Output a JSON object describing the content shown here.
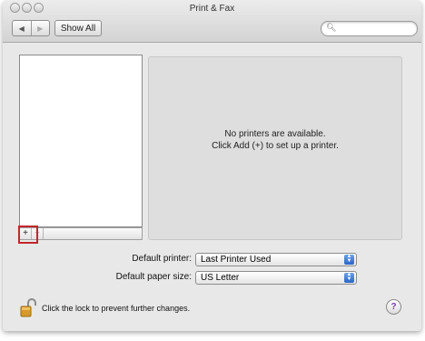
{
  "window": {
    "title": "Print & Fax",
    "toolbar": {
      "back_glyph": "◀",
      "forward_glyph": "▶",
      "show_all_label": "Show All",
      "search_placeholder": ""
    }
  },
  "printers": {
    "list_items": [],
    "add_glyph": "+",
    "remove_glyph": "−",
    "empty_message_line1": "No printers are available.",
    "empty_message_line2": "Click Add (+) to set up a printer."
  },
  "settings": {
    "default_printer_label": "Default printer:",
    "default_printer_value": "Last Printer Used",
    "default_paper_label": "Default paper size:",
    "default_paper_value": "US Letter"
  },
  "footer": {
    "lock_text": "Click the lock to prevent further changes.",
    "help_glyph": "?"
  },
  "colors": {
    "highlight": "#c0272d",
    "popup_arrow": "#2a63c8"
  }
}
